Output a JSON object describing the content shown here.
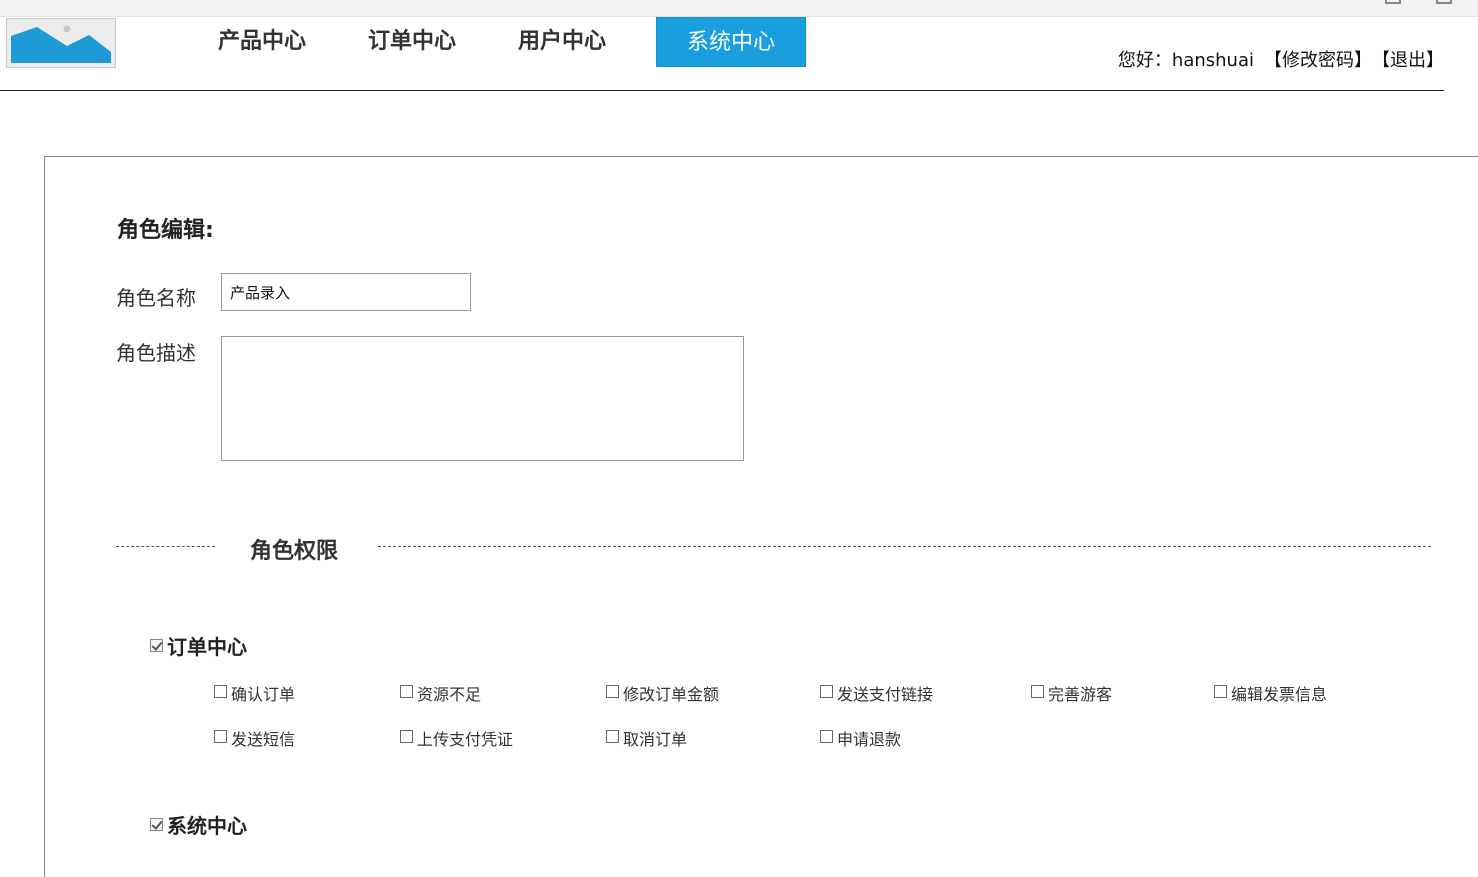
{
  "nav": {
    "items": [
      "产品中心",
      "订单中心",
      "用户中心"
    ],
    "active": "系统中心"
  },
  "user": {
    "greeting": "您好：hanshuai",
    "change_password": "【修改密码】",
    "logout": "【退出】"
  },
  "form": {
    "title": "角色编辑:",
    "name_label": "角色名称",
    "name_value": "产品录入",
    "desc_label": "角色描述",
    "desc_value": ""
  },
  "permissions": {
    "title": "角色权限",
    "groups": [
      {
        "name": "订单中心",
        "checked": true,
        "items": [
          {
            "label": "确认订单",
            "checked": false
          },
          {
            "label": "资源不足",
            "checked": false
          },
          {
            "label": "修改订单金额",
            "checked": false
          },
          {
            "label": "发送支付链接",
            "checked": false
          },
          {
            "label": "完善游客",
            "checked": false
          },
          {
            "label": "编辑发票信息",
            "checked": false
          },
          {
            "label": "发送短信",
            "checked": false
          },
          {
            "label": "上传支付凭证",
            "checked": false
          },
          {
            "label": "取消订单",
            "checked": false
          },
          {
            "label": "申请退款",
            "checked": false
          }
        ]
      },
      {
        "name": "系统中心",
        "checked": true,
        "items": []
      }
    ]
  },
  "colors": {
    "accent": "#1a9fde",
    "logo_fill": "#1e9bd7"
  },
  "icons": {
    "logo": "image-placeholder-icon"
  }
}
